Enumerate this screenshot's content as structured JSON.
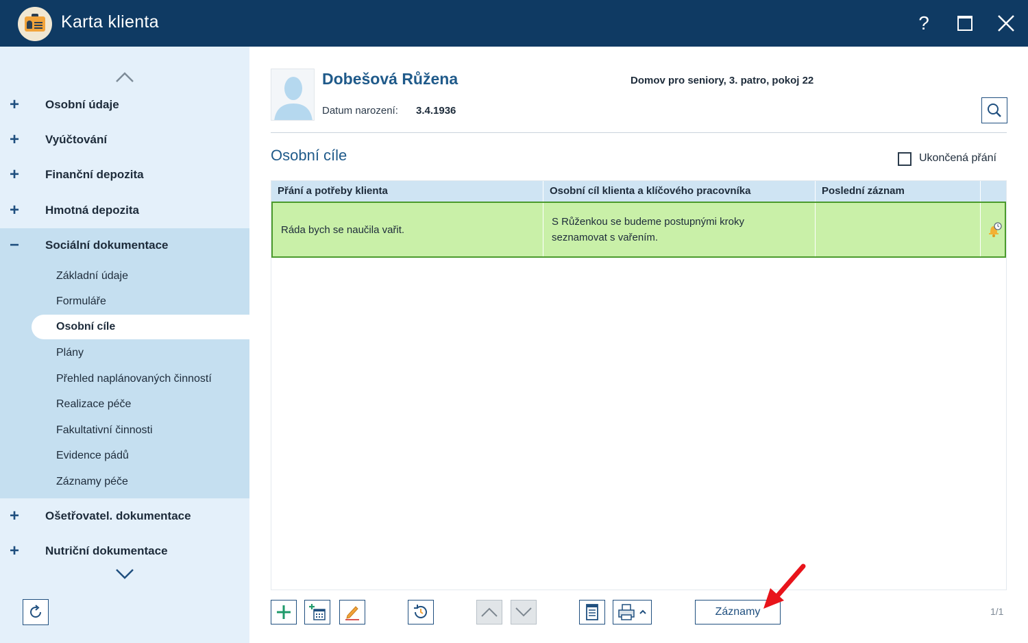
{
  "window": {
    "title": "Karta klienta",
    "help_label": "?"
  },
  "sidebar": {
    "items": [
      {
        "label": "Osobní údaje",
        "state": "+"
      },
      {
        "label": "Vyúčtování",
        "state": "+"
      },
      {
        "label": "Finanční depozita",
        "state": "+"
      },
      {
        "label": "Hmotná depozita",
        "state": "+"
      },
      {
        "label": "Sociální dokumentace",
        "state": "−"
      },
      {
        "label": "Ošetřovatel. dokumentace",
        "state": "+"
      },
      {
        "label": "Nutriční dokumentace",
        "state": "+"
      }
    ],
    "subitems": [
      "Základní údaje",
      "Formuláře",
      "Osobní cíle",
      "Plány",
      "Přehled naplánovaných činností",
      "Realizace péče",
      "Fakultativní činnosti",
      "Evidence pádů",
      "Záznamy péče"
    ],
    "active_subitem": "Osobní cíle"
  },
  "client": {
    "name": "Dobešová Růžena",
    "dob_label": "Datum narození:",
    "dob_value": "3.4.1936",
    "location": "Domov pro seniory, 3. patro, pokoj 22"
  },
  "section": {
    "title": "Osobní cíle",
    "checkbox_label": "Ukončená přání",
    "checkbox_checked": false
  },
  "grid": {
    "columns": [
      "Přání a potřeby klienta",
      "Osobní cíl klienta a klíčového pracovníka",
      "Poslední záznam"
    ],
    "rows": [
      {
        "wish": "Ráda bych se naučila vařit.",
        "goal": "S Růženkou se budeme postupnými kroky seznamovat s vařením.",
        "last_record": ""
      }
    ]
  },
  "toolbar": {
    "records_label": "Záznamy",
    "pager": "1/1"
  },
  "colors": {
    "titlebar": "#0f3a63",
    "sidebar": "#e4f0fa",
    "sidebar_expanded": "#c5dff0",
    "selected_row": "#c9f0a8",
    "selected_row_border": "#4a9a2c",
    "accent": "#1f5a8a",
    "annotation_arrow": "#e8141b"
  }
}
